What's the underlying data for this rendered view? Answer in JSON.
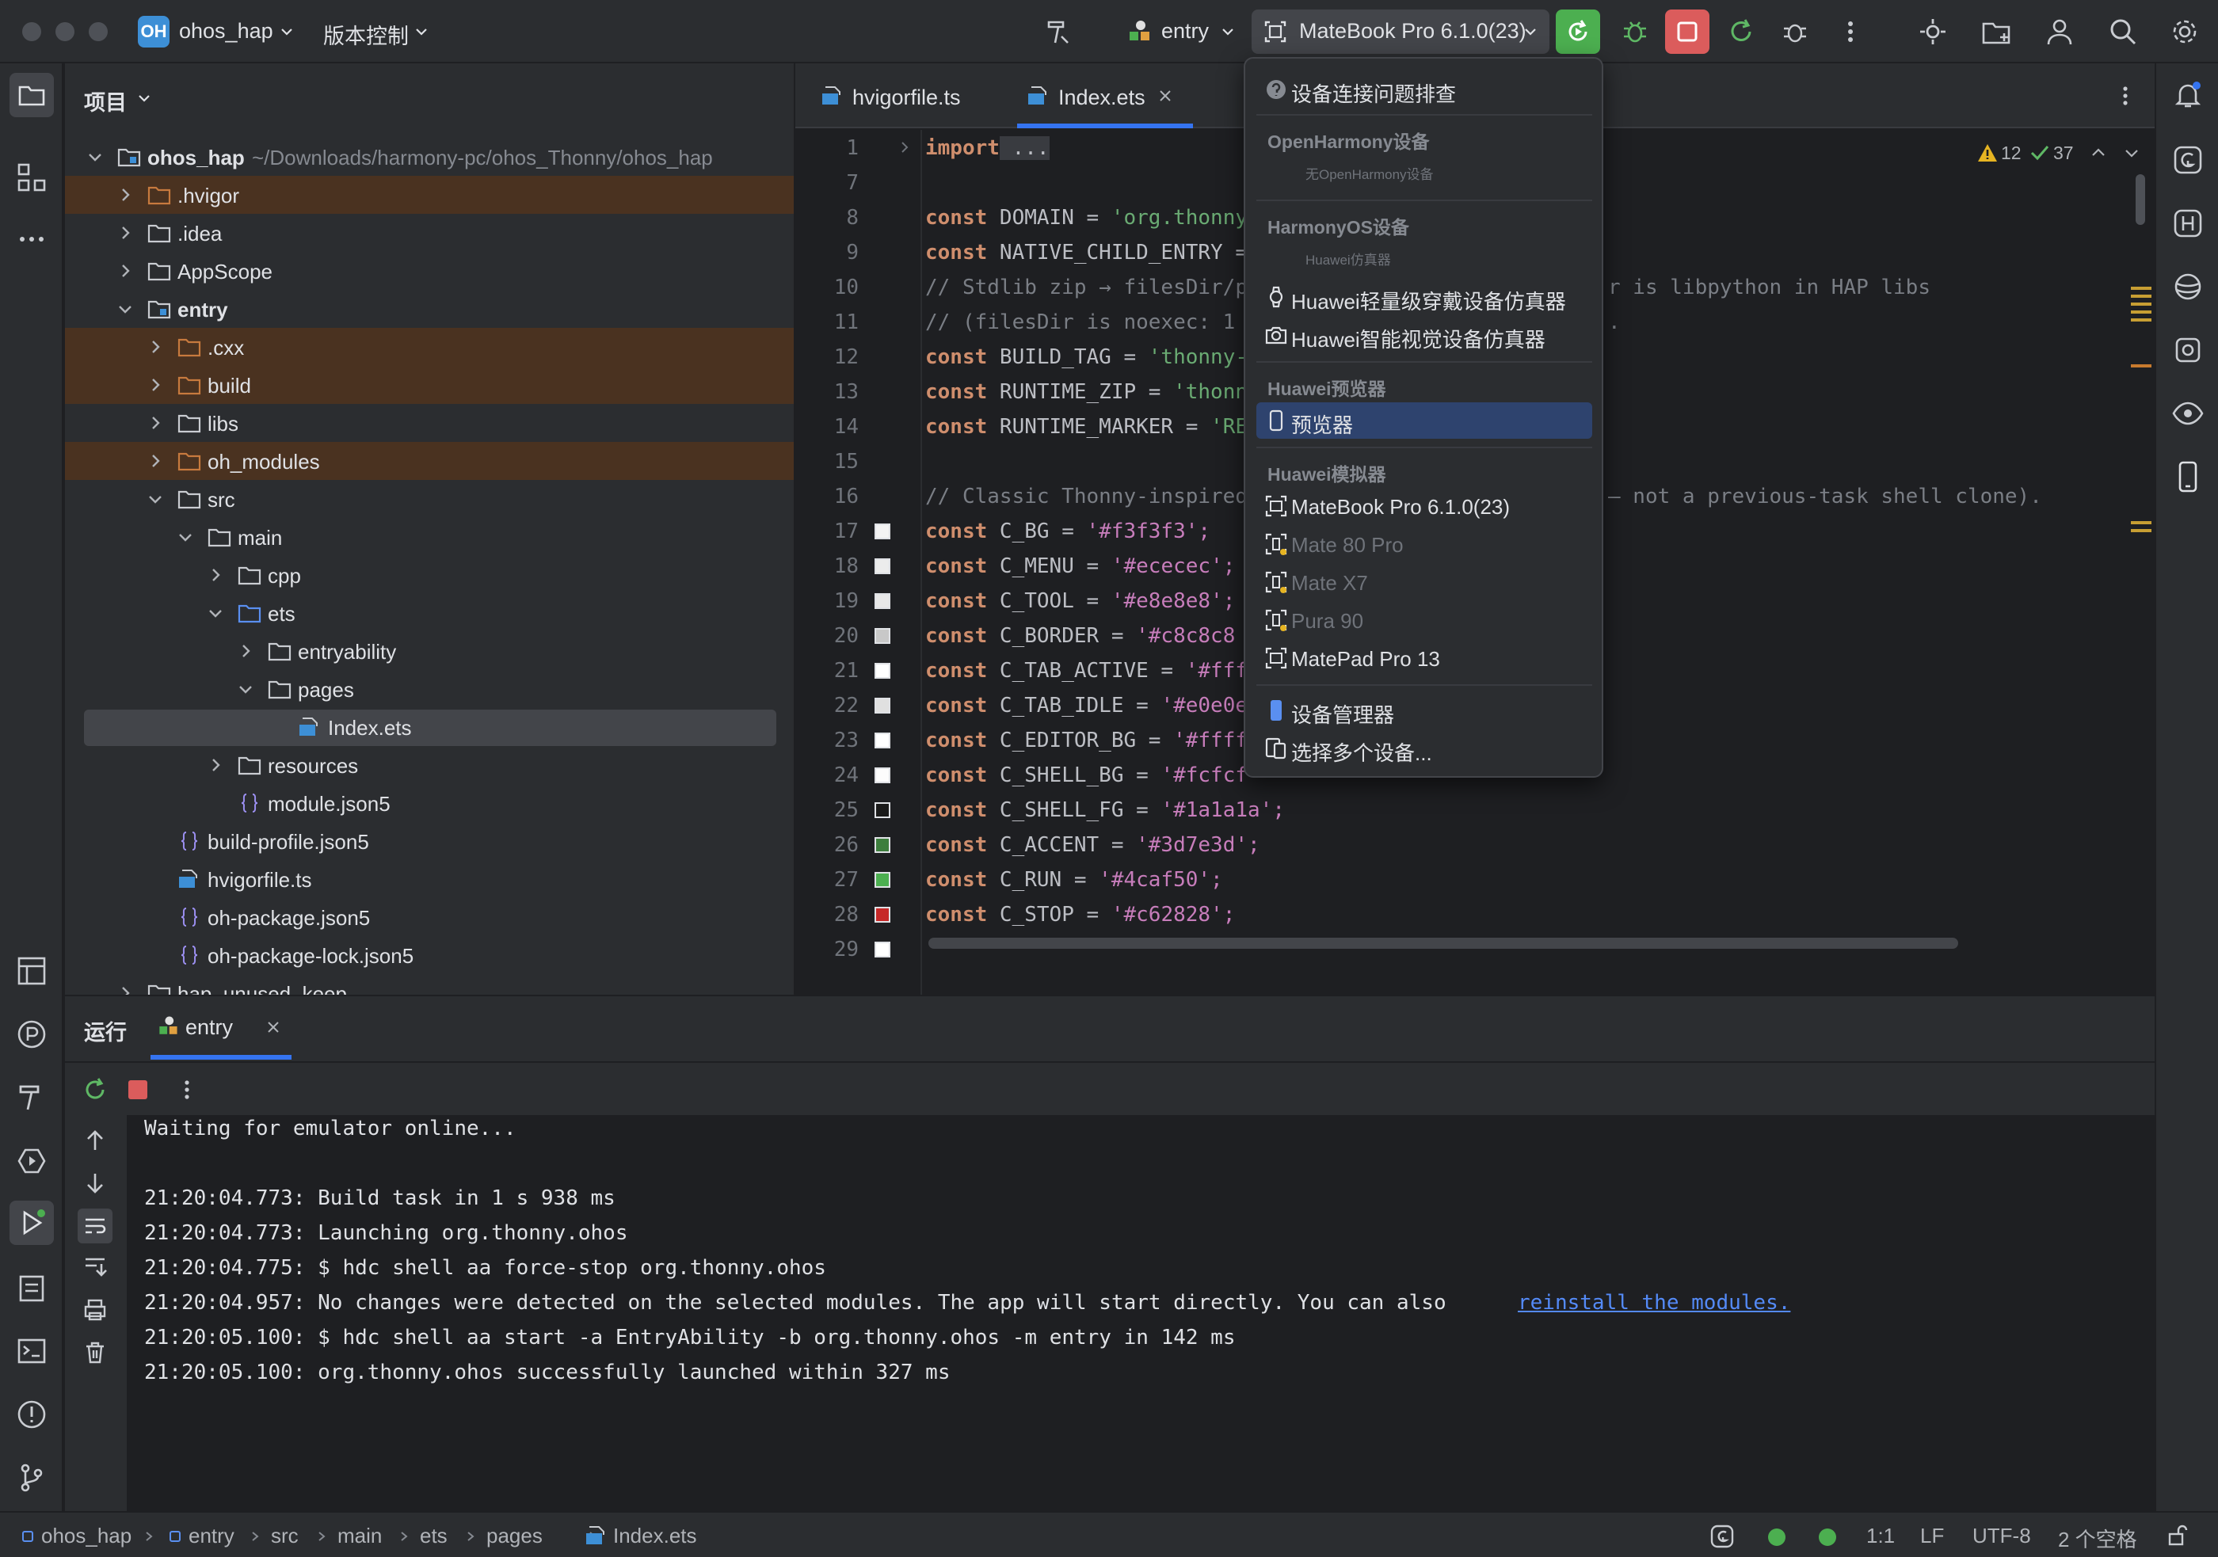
{
  "titlebar": {
    "project_badge": "OH",
    "project_name": "ohos_hap",
    "vcs": "版本控制",
    "run_config": "entry",
    "device": "MateBook Pro 6.1.0(23)"
  },
  "project_panel": {
    "title": "项目",
    "root": {
      "name": "ohos_hap",
      "path": "~/Downloads/harmony-pc/ohos_Thonny/ohos_hap"
    },
    "items": [
      {
        "label": ".hvigor"
      },
      {
        "label": ".idea"
      },
      {
        "label": "AppScope"
      },
      {
        "label": "entry"
      },
      {
        "label": ".cxx"
      },
      {
        "label": "build"
      },
      {
        "label": "libs"
      },
      {
        "label": "oh_modules"
      },
      {
        "label": "src"
      },
      {
        "label": "main"
      },
      {
        "label": "cpp"
      },
      {
        "label": "ets"
      },
      {
        "label": "entryability"
      },
      {
        "label": "pages"
      },
      {
        "label": "Index.ets"
      },
      {
        "label": "resources"
      },
      {
        "label": "module.json5"
      },
      {
        "label": "build-profile.json5"
      },
      {
        "label": "hvigorfile.ts"
      },
      {
        "label": "oh-package.json5"
      },
      {
        "label": "oh-package-lock.json5"
      },
      {
        "label": "hap_unused_keep"
      }
    ]
  },
  "editor": {
    "tabs": [
      {
        "label": "hvigorfile.ts"
      },
      {
        "label": "Index.ets"
      }
    ],
    "inspection": {
      "warnings": "12",
      "ok": "37"
    },
    "lines": [
      {
        "n": "1",
        "t": "import ..."
      },
      {
        "n": "7",
        "t": ""
      },
      {
        "n": "8",
        "t": "const DOMAIN = 'org.thonny"
      },
      {
        "n": "9",
        "t": "const NATIVE_CHILD_ENTRY ="
      },
      {
        "n": "10",
        "t": "// Stdlib zip → filesDir/p",
        "t2": "r is libpython in HAP libs"
      },
      {
        "n": "11",
        "t": "// (filesDir is noexec: 1",
        "t2": "."
      },
      {
        "n": "12",
        "t": "const BUILD_TAG = 'thonny-"
      },
      {
        "n": "13",
        "t": "const RUNTIME_ZIP = 'thonn"
      },
      {
        "n": "14",
        "t": "const RUNTIME_MARKER = 'RE"
      },
      {
        "n": "15",
        "t": ""
      },
      {
        "n": "16",
        "t": "// Classic Thonny-inspired",
        "t2": "— not a previous-task shell clone)."
      },
      {
        "n": "17",
        "t": "const C_BG = '#f3f3f3';"
      },
      {
        "n": "18",
        "t": "const C_MENU = '#ececec';"
      },
      {
        "n": "19",
        "t": "const C_TOOL = '#e8e8e8';"
      },
      {
        "n": "20",
        "t": "const C_BORDER = '#c8c8c8"
      },
      {
        "n": "21",
        "t": "const C_TAB_ACTIVE = '#fff"
      },
      {
        "n": "22",
        "t": "const C_TAB_IDLE = '#e0e0e"
      },
      {
        "n": "23",
        "t": "const C_EDITOR_BG = '#ffff"
      },
      {
        "n": "24",
        "t": "const C_SHELL_BG = '#fcfcf"
      },
      {
        "n": "25",
        "t": "const C_SHELL_FG = '#1a1a1a';"
      },
      {
        "n": "26",
        "t": "const C_ACCENT = '#3d7e3d';"
      },
      {
        "n": "27",
        "t": "const C_RUN = '#4caf50';"
      },
      {
        "n": "28",
        "t": "const C_STOP = '#c62828';"
      },
      {
        "n": "29",
        "t": ""
      }
    ],
    "swatches": [
      "#f3f3f3",
      "#ececec",
      "#e8e8e8",
      "#c8c8c8",
      "#ffffff",
      "#e0e0e0",
      "#ffffff",
      "#fcfcfc",
      "#1a1a1a",
      "#3d7e3d",
      "#4caf50",
      "#c62828",
      "#ffffff"
    ]
  },
  "device_dropdown": {
    "troubleshoot": "设备连接问题排查",
    "groups": {
      "openharmony": {
        "label": "OpenHarmony设备",
        "empty": "无OpenHarmony设备"
      },
      "harmonyos": {
        "label": "HarmonyOS设备",
        "sub": "Huawei仿真器",
        "items": [
          "Huawei轻量级穿戴设备仿真器",
          "Huawei智能视觉设备仿真器"
        ]
      },
      "previewer": {
        "label": "Huawei预览器",
        "items": [
          "预览器"
        ]
      },
      "emulator": {
        "label": "Huawei模拟器",
        "items": [
          "MateBook Pro 6.1.0(23)",
          "Mate 80 Pro",
          "Mate X7",
          "Pura 90",
          "MatePad Pro 13"
        ]
      }
    },
    "device_manager": "设备管理器",
    "select_multiple": "选择多个设备..."
  },
  "run_panel": {
    "title": "运行",
    "tab": "entry",
    "console": [
      "Waiting for emulator online...",
      "",
      "21:20:04.773: Build task in 1 s 938 ms",
      "21:20:04.773: Launching org.thonny.ohos",
      "21:20:04.775: $ hdc shell aa force-stop org.thonny.ohos",
      "21:20:04.957: No changes were detected on the selected modules. The app will start directly. You can also ",
      "21:20:05.100: $ hdc shell aa start -a EntryAbility -b org.thonny.ohos -m entry in 142 ms",
      "21:20:05.100: org.thonny.ohos successfully launched within 327 ms"
    ],
    "console_link": "reinstall the modules."
  },
  "statusbar": {
    "breadcrumbs": [
      "ohos_hap",
      "entry",
      "src",
      "main",
      "ets",
      "pages",
      "Index.ets"
    ],
    "position": "1:1",
    "line_sep": "LF",
    "encoding": "UTF-8",
    "indent": "2 个空格"
  },
  "colors": {
    "accent": "#3574f0",
    "run_green": "#4caf50",
    "stop_red": "#db5c5c",
    "excluded": "#4a3220"
  }
}
